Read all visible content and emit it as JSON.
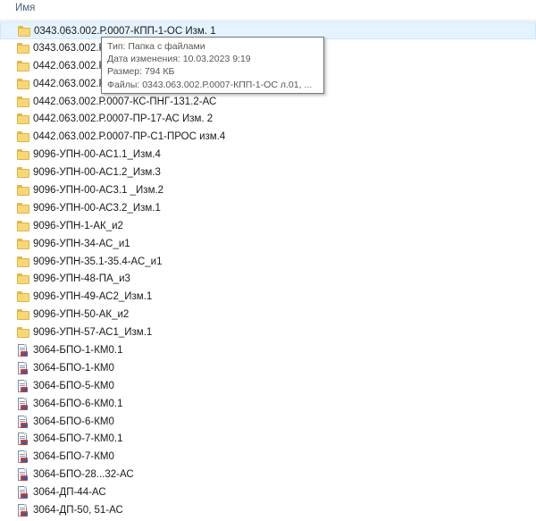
{
  "header": {
    "name_column": "Имя"
  },
  "tooltip": {
    "type_line": "Тип: Папка с файлами",
    "date_line": "Дата изменения: 10.03.2023 9:19",
    "size_line": "Размер: 794 КБ",
    "files_line": "Файлы: 0343.063.002.Р.0007-КПП-1-ОС л.01, ..."
  },
  "files": [
    {
      "name": "0343.063.002.Р.0007-КПП-1-ОС Изм. 1",
      "kind": "folder",
      "selected": true
    },
    {
      "name": "0343.063.002.Р.",
      "kind": "folder"
    },
    {
      "name": "0442.063.002.Р.",
      "kind": "folder"
    },
    {
      "name": "0442.063.002.Р.",
      "kind": "folder"
    },
    {
      "name": "0442.063.002.Р.0007-КС-ПНГ-131.2-АС",
      "kind": "folder"
    },
    {
      "name": "0442.063.002.Р.0007-ПР-17-АС Изм. 2",
      "kind": "folder"
    },
    {
      "name": "0442.063.002.Р.0007-ПР-С1-ПРОС изм.4",
      "kind": "folder"
    },
    {
      "name": "9096-УПН-00-АС1.1_Изм.4",
      "kind": "folder"
    },
    {
      "name": "9096-УПН-00-АС1.2_Изм.3",
      "kind": "folder"
    },
    {
      "name": "9096-УПН-00-АС3.1 _Изм.2",
      "kind": "folder"
    },
    {
      "name": "9096-УПН-00-АС3.2_Изм.1",
      "kind": "folder"
    },
    {
      "name": "9096-УПН-1-АК_и2",
      "kind": "folder"
    },
    {
      "name": "9096-УПН-34-АС_и1",
      "kind": "folder"
    },
    {
      "name": "9096-УПН-35.1-35.4-АС_и1",
      "kind": "folder"
    },
    {
      "name": "9096-УПН-48-ПА_и3",
      "kind": "folder"
    },
    {
      "name": "9096-УПН-49-АС2_Изм.1",
      "kind": "folder"
    },
    {
      "name": "9096-УПН-50-АК_и2",
      "kind": "folder"
    },
    {
      "name": "9096-УПН-57-АС1_Изм.1",
      "kind": "folder"
    },
    {
      "name": "3064-БПО-1-КМ0.1",
      "kind": "document"
    },
    {
      "name": "3064-БПО-1-КМ0",
      "kind": "document"
    },
    {
      "name": "3064-БПО-5-КМ0",
      "kind": "document"
    },
    {
      "name": "3064-БПО-6-КМ0.1",
      "kind": "document"
    },
    {
      "name": "3064-БПО-6-КМ0",
      "kind": "document"
    },
    {
      "name": "3064-БПО-7-КМ0.1",
      "kind": "document"
    },
    {
      "name": "3064-БПО-7-КМ0",
      "kind": "document"
    },
    {
      "name": "3064-БПО-28...32-АС",
      "kind": "document"
    },
    {
      "name": "3064-ДП-44-АС",
      "kind": "document"
    },
    {
      "name": "3064-ДП-50, 51-АС",
      "kind": "document"
    }
  ]
}
